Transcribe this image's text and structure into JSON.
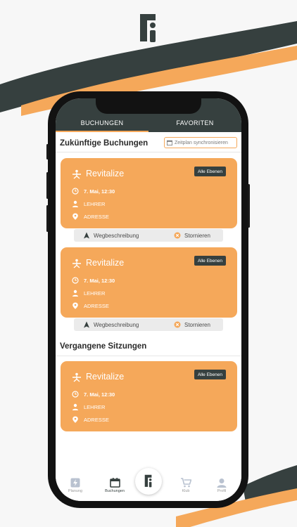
{
  "colors": {
    "accent": "#f5a85a",
    "dark": "#36403f",
    "screen_bg": "#ffffff"
  },
  "tabs": [
    {
      "label": "BUCHUNGEN",
      "active": true
    },
    {
      "label": "FAVORITEN",
      "active": false
    }
  ],
  "upcoming": {
    "title": "Zukünftige Buchungen",
    "sync_label": "Zeitplan synchronisieren",
    "cards": [
      {
        "title": "Revitalize",
        "badge": "Alle Ebenen",
        "date": "7. Mai, 12:30",
        "teacher": "LEHRER",
        "address": "ADRESSE",
        "directions": "Wegbeschreibung",
        "cancel": "Stornieren"
      },
      {
        "title": "Revitalize",
        "badge": "Alle Ebenen",
        "date": "7. Mai, 12:30",
        "teacher": "LEHRER",
        "address": "ADRESSE",
        "directions": "Wegbeschreibung",
        "cancel": "Stornieren"
      }
    ]
  },
  "past": {
    "title": "Vergangene Sitzungen",
    "cards": [
      {
        "title": "Revitalize",
        "badge": "Alle Ebenen",
        "date": "7. Mai, 12:30",
        "teacher": "LEHRER",
        "address": "ADRESSE"
      }
    ]
  },
  "nav": [
    {
      "label": "Planung",
      "icon": "lightning-icon"
    },
    {
      "label": "Buchungen",
      "icon": "calendar-icon",
      "active": true
    },
    {
      "label": "",
      "icon": "brand-logo-icon"
    },
    {
      "label": "Klub",
      "icon": "cart-icon"
    },
    {
      "label": "Profil",
      "icon": "person-icon"
    }
  ]
}
